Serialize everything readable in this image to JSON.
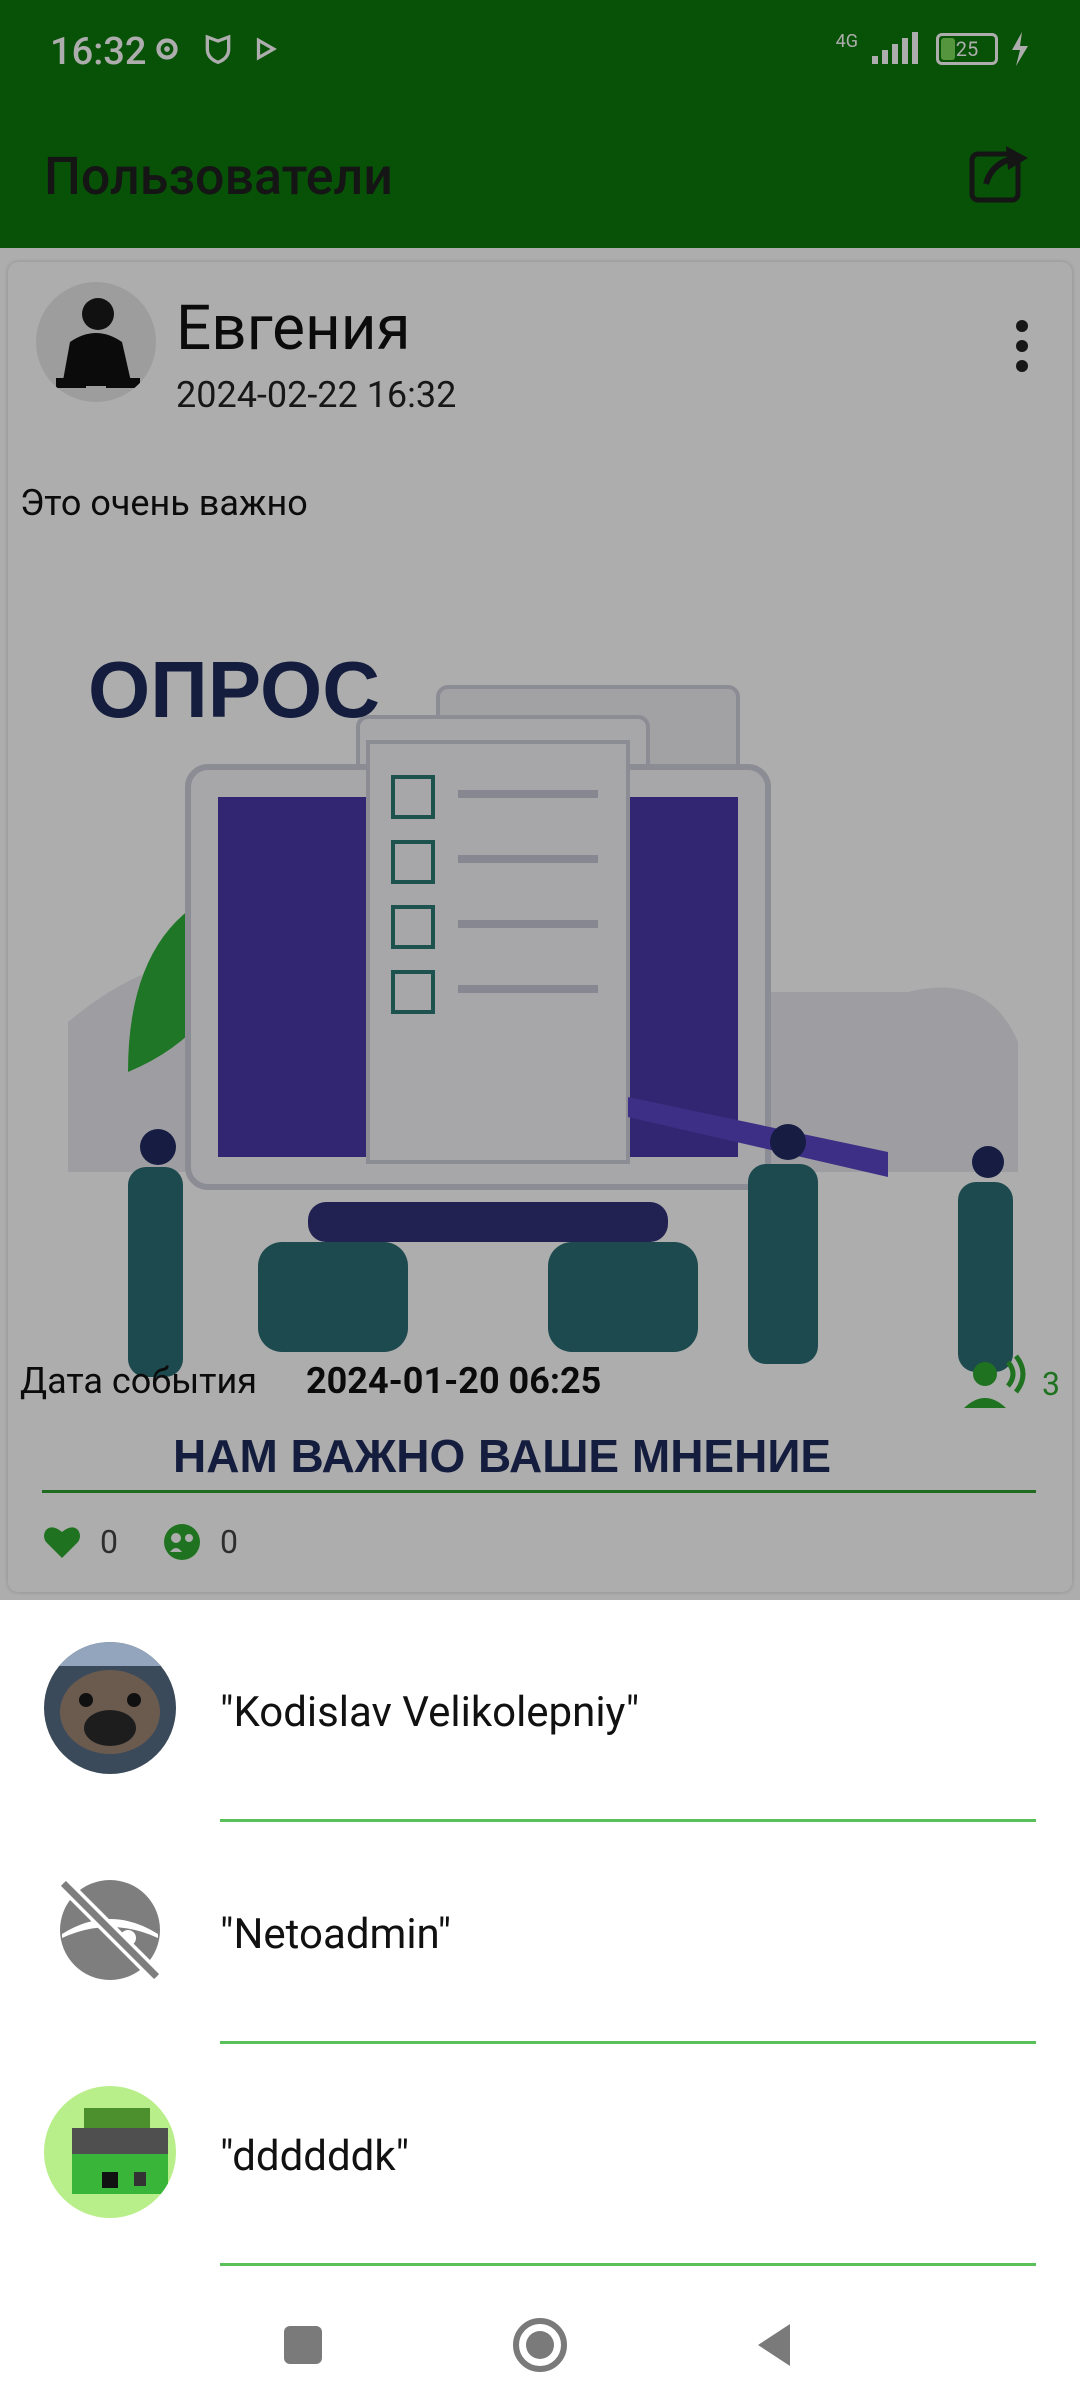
{
  "status": {
    "time": "16:32",
    "network": "4G",
    "battery": "25"
  },
  "app_bar": {
    "title": "Пользователи"
  },
  "post": {
    "author": "Евгения",
    "published": "2024-02-22 16:32",
    "text": "Это очень важно",
    "image_title": "ОПРОС",
    "image_subtitle": "НАМ ВАЖНО ВАШЕ МНЕНИЕ",
    "event_label": "Дата события",
    "event_date": "2024-01-20 06:25",
    "participants_count": "3",
    "likes_count": "0",
    "mentions_count": "0"
  },
  "sheet": {
    "users": [
      {
        "name": "\"Kodislav Velikolepniy\""
      },
      {
        "name": "\"Netoadmin\""
      },
      {
        "name": "\"ddddddk\""
      }
    ]
  },
  "colors": {
    "primary": "#0b7a0b",
    "accent": "#2ea82e",
    "divider": "#59c05a"
  },
  "icons": {
    "share": "share-icon",
    "menu": "more-vert-icon",
    "participants": "participants-icon",
    "like": "heart-icon",
    "mentions": "mentions-icon",
    "no_avatar": "no-avatar-icon"
  }
}
